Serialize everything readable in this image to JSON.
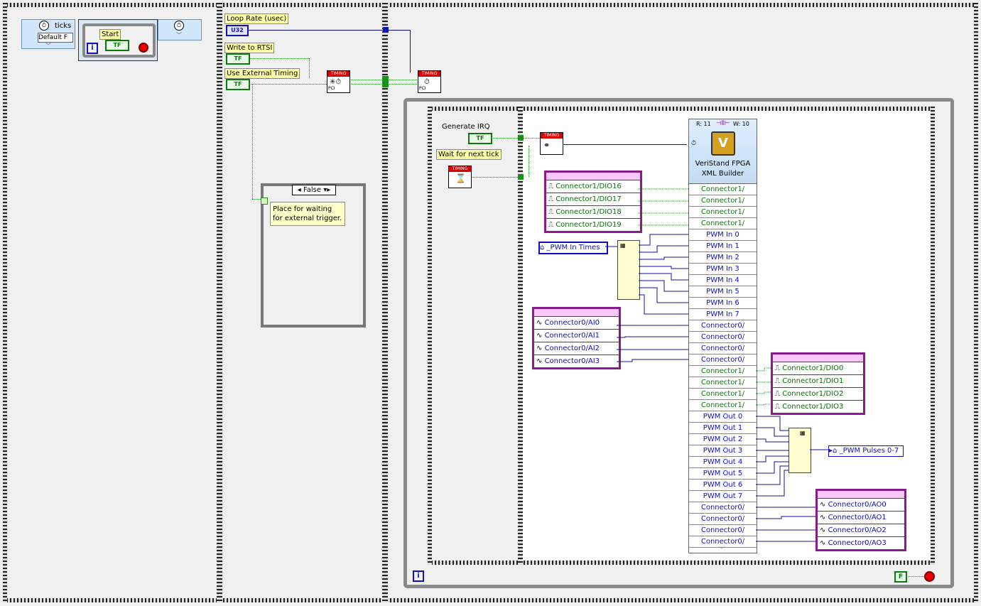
{
  "left_frame": {
    "ticks_label": "ticks",
    "default_text": "Default F",
    "start_label": "Start"
  },
  "middle_frame": {
    "loop_rate_label": "Loop Rate (usec)",
    "u32_label": "U32",
    "write_rtsi_label": "Write to  RTSI",
    "use_ext_timing_label": "Use External Timing",
    "bool_tf": "TF",
    "case_selector": "False",
    "case_note": "Place for waiting for external trigger.",
    "timing_hdr": "TIMING",
    "pci_label": "PCI"
  },
  "inner_loop": {
    "generate_irq_label": "Generate IRQ",
    "wait_tick_label": "Wait for next tick",
    "pwm_in_times": "_PWM In Times",
    "pwm_pulses": "_PWM Pulses 0-7",
    "false_const": "F",
    "iter_label": "i"
  },
  "fpga_node": {
    "read_count": "R: 11",
    "write_count": "W: 10",
    "title_line1": "VeriStand FPGA",
    "title_line2": "XML Builder",
    "terminals": [
      {
        "label": "Connector1/",
        "kind": "g"
      },
      {
        "label": "Connector1/",
        "kind": "g"
      },
      {
        "label": "Connector1/",
        "kind": "g"
      },
      {
        "label": "Connector1/",
        "kind": "g"
      },
      {
        "label": "PWM In 0",
        "kind": "b"
      },
      {
        "label": "PWM In 1",
        "kind": "b"
      },
      {
        "label": "PWM In 2",
        "kind": "b"
      },
      {
        "label": "PWM In 3",
        "kind": "b"
      },
      {
        "label": "PWM In 4",
        "kind": "b"
      },
      {
        "label": "PWM In 5",
        "kind": "b"
      },
      {
        "label": "PWM In 6",
        "kind": "b"
      },
      {
        "label": "PWM In 7",
        "kind": "b"
      },
      {
        "label": "Connector0/",
        "kind": "b"
      },
      {
        "label": "Connector0/",
        "kind": "b"
      },
      {
        "label": "Connector0/",
        "kind": "b"
      },
      {
        "label": "Connector0/",
        "kind": "b"
      },
      {
        "label": "Connector1/",
        "kind": "g"
      },
      {
        "label": "Connector1/",
        "kind": "g"
      },
      {
        "label": "Connector1/",
        "kind": "g"
      },
      {
        "label": "Connector1/",
        "kind": "g"
      },
      {
        "label": "PWM Out 0",
        "kind": "b"
      },
      {
        "label": "PWM Out 1",
        "kind": "b"
      },
      {
        "label": "PWM Out 2",
        "kind": "b"
      },
      {
        "label": "PWM Out 3",
        "kind": "b"
      },
      {
        "label": "PWM Out 4",
        "kind": "b"
      },
      {
        "label": "PWM Out 5",
        "kind": "b"
      },
      {
        "label": "PWM Out 6",
        "kind": "b"
      },
      {
        "label": "PWM Out 7",
        "kind": "b"
      },
      {
        "label": "Connector0/",
        "kind": "b"
      },
      {
        "label": "Connector0/",
        "kind": "b"
      },
      {
        "label": "Connector0/",
        "kind": "b"
      },
      {
        "label": "Connector0/",
        "kind": "b"
      }
    ]
  },
  "clusters": {
    "dio_in": [
      "Connector1/DIO16",
      "Connector1/DIO17",
      "Connector1/DIO18",
      "Connector1/DIO19"
    ],
    "ai": [
      "Connector0/AI0",
      "Connector0/AI1",
      "Connector0/AI2",
      "Connector0/AI3"
    ],
    "dio_out": [
      "Connector1/DIO0",
      "Connector1/DIO1",
      "Connector1/DIO2",
      "Connector1/DIO3"
    ],
    "ao": [
      "Connector0/AO0",
      "Connector0/AO1",
      "Connector0/AO2",
      "Connector0/AO3"
    ]
  }
}
